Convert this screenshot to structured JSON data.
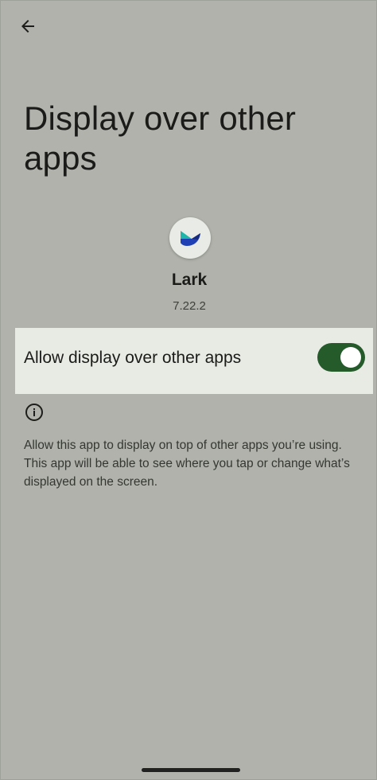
{
  "header": {
    "back_icon": "arrow-back-icon"
  },
  "page": {
    "title": "Display over other apps"
  },
  "app": {
    "icon": "lark-app-icon",
    "name": "Lark",
    "version": "7.22.2"
  },
  "permission": {
    "label": "Allow display over other apps",
    "enabled": true
  },
  "info": {
    "icon": "info-icon",
    "description": "Allow this app to display on top of other apps you’re using. This app will be able to see where you tap or change what’s displayed on the screen."
  },
  "colors": {
    "background": "#b0b2ab",
    "row_highlight": "#e8eae4",
    "switch_on": "#255a2b"
  }
}
